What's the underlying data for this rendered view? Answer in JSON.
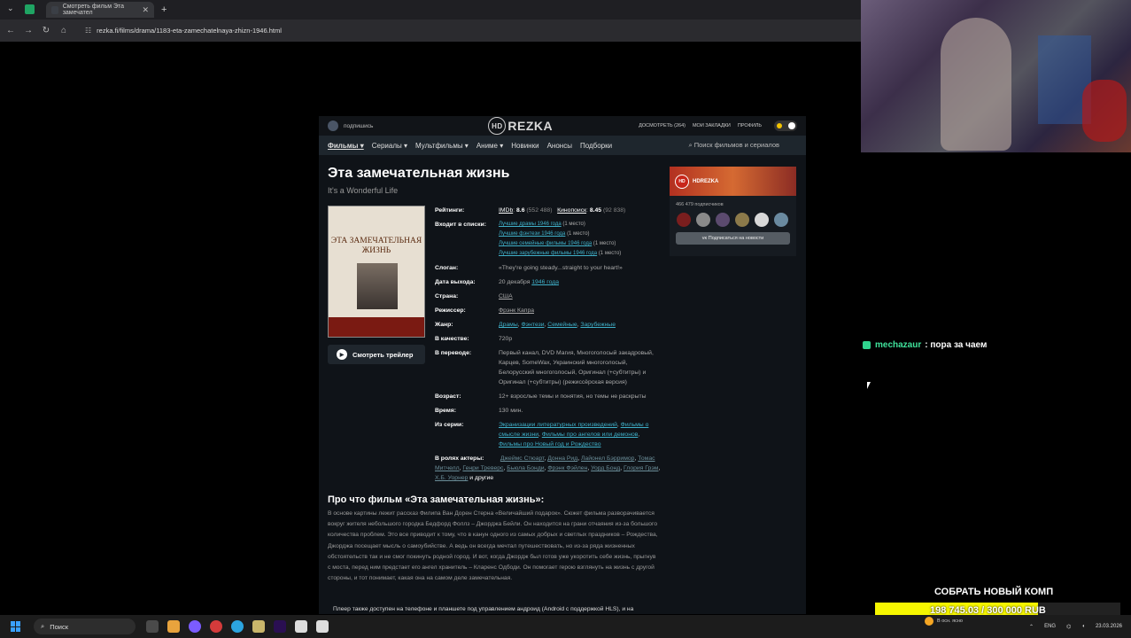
{
  "browser": {
    "tab_title": "Смотреть фильм Эта замечател",
    "tab_close": "✕",
    "new_tab": "+",
    "url": "rezka.fi/films/drama/1183-eta-zamechatelnaya-zhizn-1946.html"
  },
  "site": {
    "subscribe": "подпишись",
    "logo_hd": "HD",
    "logo_text": "REZKA",
    "header_links": [
      "ДОСМОТРЕТЬ (264)",
      "МОИ ЗАКЛАДКИ",
      "ПРОФИЛЬ"
    ],
    "menu": [
      "Фильмы ▾",
      "Сериалы ▾",
      "Мультфильмы ▾",
      "Аниме ▾",
      "Новинки",
      "Анонсы",
      "Подборки"
    ],
    "search_placeholder": "Поиск фильмов и сериалов"
  },
  "film": {
    "title": "Эта замечательная жизнь",
    "original_title": "It's a Wonderful Life",
    "poster_title": "ЭТА ЗАМЕЧАТЕЛЬНАЯ ЖИЗНЬ",
    "trailer_label": "Смотреть трейлер",
    "ratings_label": "Рейтинги:",
    "imdb_label": "IMDb",
    "imdb_score": "8.6",
    "imdb_votes": "(552 488)",
    "kp_label": "Кинопоиск",
    "kp_score": "8.45",
    "kp_votes": "(92 838)",
    "lists_label": "Входит в списки:",
    "lists": [
      {
        "name": "Лучшие драмы 1946 года",
        "place": "(1 место)"
      },
      {
        "name": "Лучшие фэнтези 1946 года",
        "place": "(1 место)"
      },
      {
        "name": "Лучшие семейные фильмы 1946 года",
        "place": "(1 место)"
      },
      {
        "name": "Лучшие зарубежные фильмы 1946 года",
        "place": "(1 место)"
      }
    ],
    "slogan_label": "Слоган:",
    "slogan": "«They're going steady...straight to your heart!»",
    "release_label": "Дата выхода:",
    "release_date": "20 декабря",
    "release_year": "1946 года",
    "country_label": "Страна:",
    "country": "США",
    "director_label": "Режиссер:",
    "director": "Фрэнк Капра",
    "genre_label": "Жанр:",
    "genres": [
      "Драмы",
      "Фэнтези",
      "Семейные",
      "Зарубежные"
    ],
    "quality_label": "В качестве:",
    "quality": "720p",
    "translation_label": "В переводе:",
    "translation": "Первый канал, DVD Магия, Многоголосый закадровый, Карцев, SomeWax, Украинский многоголосый, Белорусский многоголосый, Оригинал (+субтитры) и Оригинал (+субтитры) (режиссёрская версия)",
    "age_label": "Возраст:",
    "age": "12+",
    "age_text": "взрослые темы и понятия, но темы не раскрыты",
    "time_label": "Время:",
    "time": "130 мин.",
    "series_label": "Из серии:",
    "series": [
      "Экранизации литературных произведений",
      "Фильмы о смысле жизни",
      "Фильмы про ангелов или демонов",
      "Фильмы про Новый год и Рождество"
    ],
    "cast_label": "В ролях актеры:",
    "cast": [
      "Джеймс Стюарт",
      "Донна Рид",
      "Лайонел Бэрримор",
      "Томас Митчелл",
      "Генри Треверс",
      "Бьюла Бонди",
      "Фрэнк Фэйлен",
      "Уорд Бонд",
      "Глория Грэм",
      "Х.Б. Уорнер"
    ],
    "cast_more": "и другие",
    "about_heading": "Про что фильм «Эта замечательная жизнь»:",
    "about_text": "В основе картины лежит рассказ Филипа Ван Дорен Стерна «Величайший подарок». Сюжет фильма разворачивается вокруг жителя небольшого городка Бедфорд Фоллз – Джорджа Бейли. Он находится на грани отчаяния из-за большого количества проблем. Это все приводит к тому, что в канун одного из самых добрых и светлых праздников – Рождества, Джорджа посещает мысль о самоубийстве. А ведь он всегда мечтал путешествовать, но из-за ряда жизненных обстоятельств так и не смог покинуть родной город. И вот, когда Джордж был готов уже укоротить себе жизнь, прыгнув с моста, перед ним предстает его ангел хранитель – Кларенс Одбоди. Он помогает герою взглянуть на жизнь с другой стороны, и тот понимает, какая она на самом деле замечательная.",
    "player_note": "Плеер также доступен на телефоне и планшете под управлением андроид (Android с поддержкой HLS), и на"
  },
  "widget": {
    "brand": "HDREZKA",
    "subscribers": "466 479 подписчиков",
    "button": "Подписаться на новости"
  },
  "stream": {
    "chat_user": "mechazaur",
    "chat_sep": ":",
    "chat_message": "пора за чаем",
    "goal_title": "СОБРАТЬ НОВЫЙ КОМП",
    "goal_text": "198 745.03 / 300 000 RUB",
    "goal_fraction": 0.6625
  },
  "taskbar": {
    "search": "Поиск",
    "weather": "В осн. ясно",
    "lang": "ENG",
    "date": "23.03.2026"
  }
}
